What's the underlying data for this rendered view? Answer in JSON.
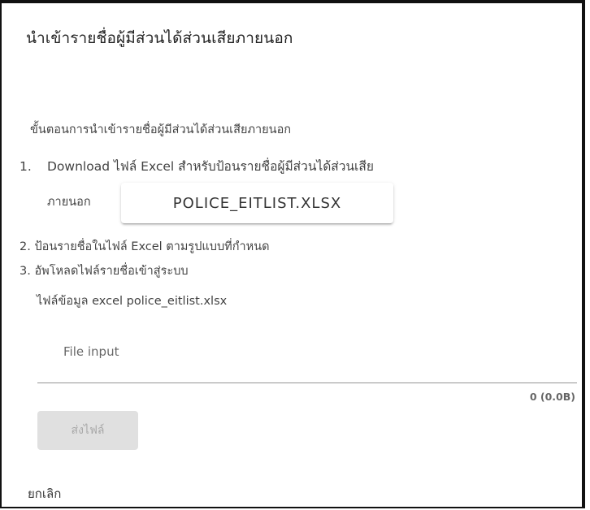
{
  "dialog": {
    "title": "นำเข้ารายชื่อผู้มีส่วนได้ส่วนเสียภายนอก",
    "intro": "ขั้นตอนการนำเข้ารายชื่อผู้มีส่วนได้ส่วนเสียภายนอก",
    "step1": {
      "number": "1.",
      "text": "Download ไฟล์ Excel สำหรับป้อนรายชื่อผู้มีส่วนได้ส่วนเสีย",
      "continuation": "ภายนอก",
      "download_label": "POLICE_EITLIST.XLSX"
    },
    "step2": "2. ป้อนรายชื่อในไฟล์ Excel ตามรูปแบบที่กำหนด",
    "step3": "3. อัพโหลดไฟล์รายชื่อเข้าสู่ระบบ",
    "file_info": "ไฟล์ข้อมูล excel police_eitlist.xlsx",
    "file_input": {
      "placeholder": "File input",
      "count": "0 (0.0B)"
    },
    "submit_label": "ส่งไฟล์",
    "cancel_label": "ยกเลิก"
  },
  "colors": {
    "border": "#111111",
    "text": "#212121",
    "disabled_bg": "#e0e0e0"
  }
}
